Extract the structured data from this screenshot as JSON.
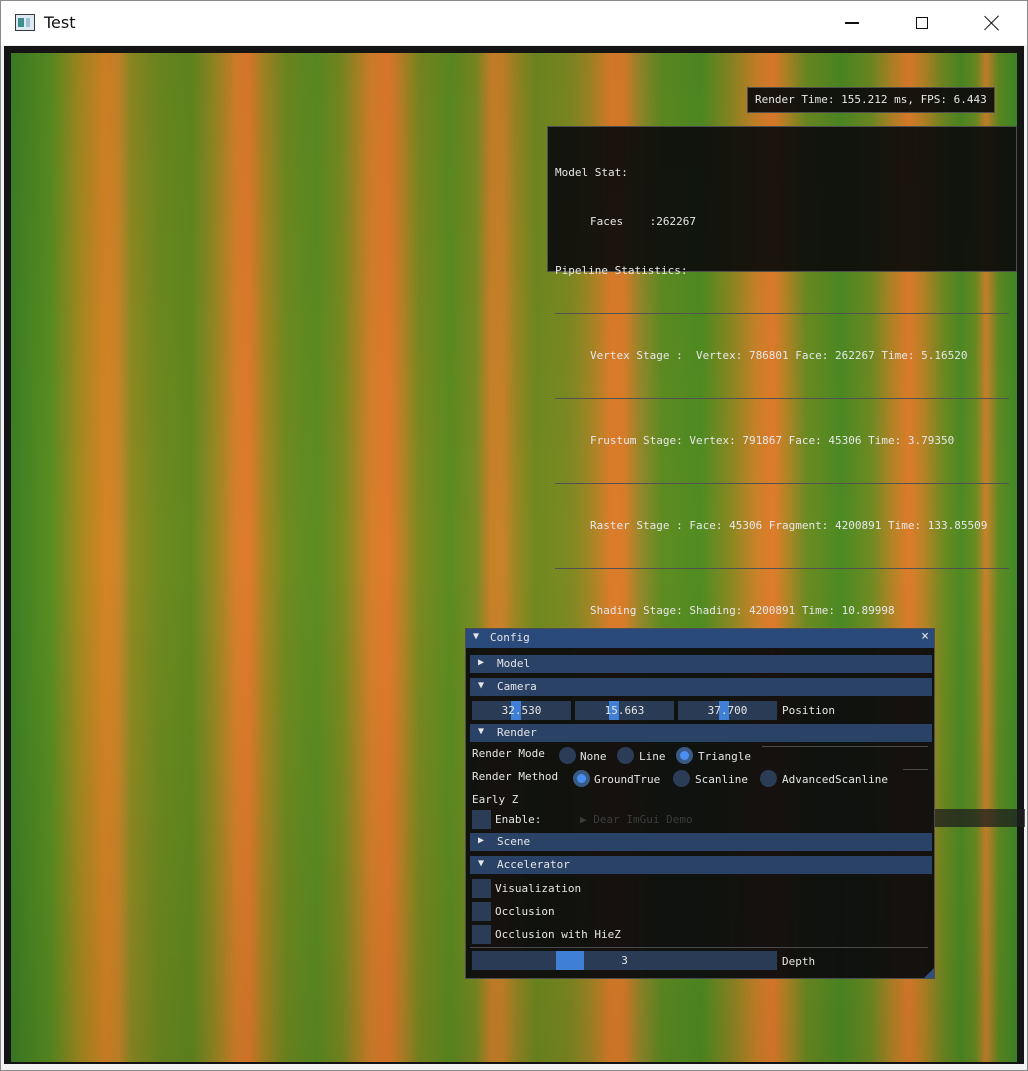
{
  "window": {
    "title": "Test"
  },
  "overlay": {
    "fps": "Render Time: 155.212 ms, FPS: 6.443",
    "model_stat": "Model Stat:",
    "faces": "Faces    :262267",
    "pipeline": "Pipeline Statistics:",
    "vertex_stage": "Vertex Stage :  Vertex: 786801 Face: 262267 Time: 5.16520",
    "frustum_stage": "Frustum Stage: Vertex: 791867 Face: 45306 Time: 3.79350",
    "raster_stage": "Raster Stage : Face: 45306 Fragment: 4200891 Time: 133.85509",
    "shading_stage": "Shading Stage: Shading: 4200891 Time: 10.89998"
  },
  "config": {
    "title": "Config",
    "close": "×",
    "sections": {
      "model": "Model",
      "camera": "Camera",
      "render": "Render",
      "scene": "Scene",
      "accelerator": "Accelerator"
    },
    "camera": {
      "x": "32.530",
      "y": "15.663",
      "z": "37.700",
      "position_label": "Position"
    },
    "render": {
      "mode_label": "Render Mode",
      "modes": [
        "None",
        "Line",
        "Triangle"
      ],
      "mode_selected": "Triangle",
      "method_label": "Render Method",
      "methods": [
        "GroundTrue",
        "Scanline",
        "AdvancedScanline"
      ],
      "method_selected": "GroundTrue",
      "early_z_label": "Early Z",
      "enable_label": "Enable:",
      "enable_checked": false,
      "demo_label": "▶  Dear ImGui Demo"
    },
    "accelerator": {
      "visualization": "Visualization",
      "occlusion": "Occlusion",
      "occlusion_hiez": "Occlusion with HieZ",
      "depth_value": "3",
      "depth_label": "Depth"
    }
  },
  "colors": {
    "title_active": "#294a7a",
    "header": "#294266",
    "frame": "#2b3c57",
    "accent": "#4a8ff0"
  },
  "icons": {
    "collapse_open": "▼",
    "collapse_closed": "▶"
  }
}
